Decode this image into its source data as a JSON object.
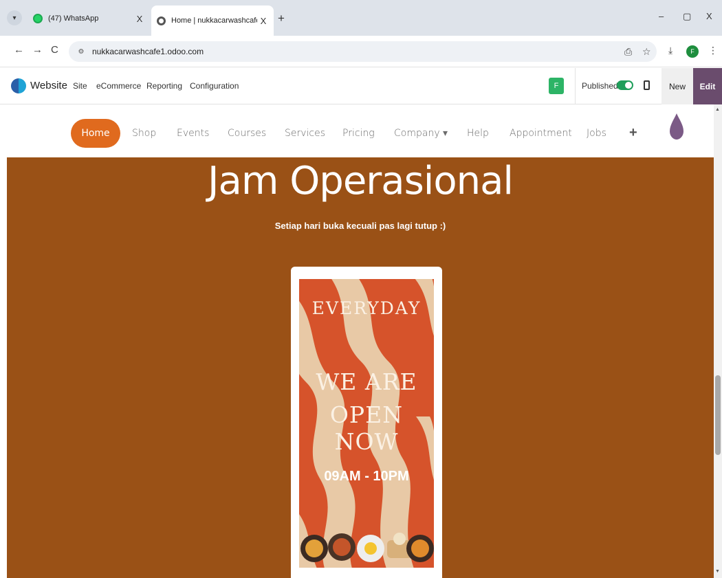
{
  "browser": {
    "tabs": [
      {
        "title": "(47) WhatsApp",
        "close": "X"
      },
      {
        "title": "Home | nukkacarwashcafe",
        "close": "X"
      }
    ],
    "new_tab": "+",
    "window_controls": {
      "minimize": "–",
      "restore": "▢",
      "close": "X"
    },
    "nav": {
      "back": "←",
      "forward": "→",
      "reload": "C"
    },
    "url": "nukkacarwashcafe1.odoo.com",
    "profile_initial": "F"
  },
  "odoo": {
    "app_name": "Website",
    "menu": [
      "Site",
      "eCommerce",
      "Reporting",
      "Configuration"
    ],
    "user_initial": "F",
    "published_label": "Published",
    "published": true,
    "new_label": "New",
    "edit_label": "Edit"
  },
  "site_nav": {
    "items": [
      "Home",
      "Shop",
      "Events",
      "Courses",
      "Services",
      "Pricing",
      "Company ▾",
      "Help",
      "Appointment",
      "Jobs"
    ],
    "add_label": "+",
    "active": "Home"
  },
  "section": {
    "title": "Jam Operasional",
    "subtitle": "Setiap hari buka kecuali pas lagi tutup :)"
  },
  "poster": {
    "line1": "EVERYDAY",
    "line2": "WE ARE",
    "line3": "OPEN NOW",
    "hours": "09AM - 10PM"
  },
  "colors": {
    "section_bg": "#9a5116",
    "nav_active": "#e06a1e",
    "edit_bg": "#6a4c6d",
    "poster_red": "#d6532b",
    "poster_cream": "#e8c9a6"
  },
  "icons": [
    "tab-search-icon",
    "whatsapp-icon",
    "odoo-icon",
    "site-info-icon",
    "install-app-icon",
    "star-icon",
    "download-icon",
    "menu-icon",
    "mobile-preview-icon",
    "odoo-logo-icon",
    "site-logo-icon"
  ]
}
